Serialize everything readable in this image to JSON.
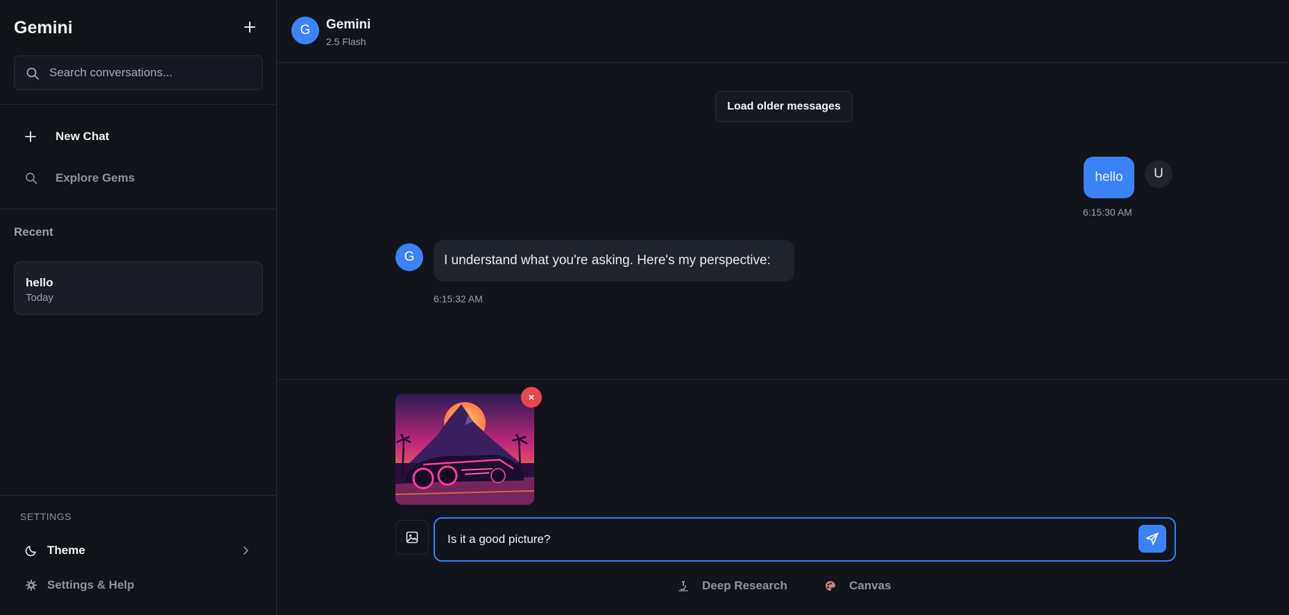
{
  "sidebar": {
    "brand": "Gemini",
    "search_placeholder": "Search conversations...",
    "new_chat": "New Chat",
    "explore_gems": "Explore Gems",
    "recent_heading": "Recent",
    "recent_items": [
      {
        "title": "hello",
        "date": "Today"
      }
    ],
    "settings_heading": "SETTINGS",
    "theme_label": "Theme",
    "help_label": "Settings & Help"
  },
  "header": {
    "avatar_letter": "G",
    "name": "Gemini",
    "model": "2.5 Flash"
  },
  "conversation": {
    "load_older": "Load older messages",
    "messages": [
      {
        "role": "user",
        "avatar": "U",
        "text": "hello",
        "time": "6:15:30 AM"
      },
      {
        "role": "assistant",
        "avatar": "G",
        "text": "I understand what you're asking. Here's my perspective:",
        "time": "6:15:32 AM"
      }
    ]
  },
  "composer": {
    "remove_label": "×",
    "input_value": "Is it a good picture?",
    "tools": [
      {
        "label": "Deep Research",
        "icon": "microscope-icon"
      },
      {
        "label": "Canvas",
        "icon": "palette-icon"
      }
    ]
  },
  "colors": {
    "accent": "#3b82f6",
    "background": "#12141b",
    "danger": "#e5484d"
  }
}
